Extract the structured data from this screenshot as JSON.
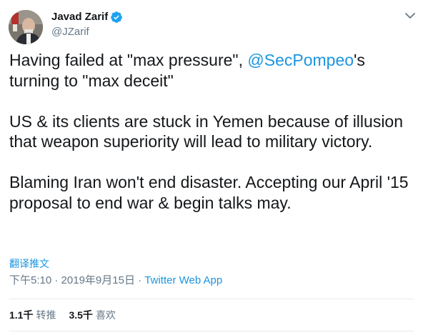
{
  "author": {
    "display_name": "Javad Zarif",
    "handle": "@JZarif",
    "verified": true
  },
  "tweet": {
    "line1_before": "Having failed at \"max pressure\", ",
    "mention": "@SecPompeo",
    "line1_after": "'s turning to \"max deceit\"",
    "paragraph2": "US & its clients are stuck in Yemen because of illusion that weapon superiority will lead to military victory.",
    "paragraph3": "Blaming Iran won't end disaster. Accepting our April '15 proposal to end war & begin talks may."
  },
  "translate_label": "翻译推文",
  "meta": {
    "time": "下午5:10",
    "separator": " · ",
    "date": "2019年9月15日",
    "source": "Twitter Web App"
  },
  "stats": {
    "retweets_count": "1.1千",
    "retweets_label": "转推",
    "likes_count": "3.5千",
    "likes_label": "喜欢"
  },
  "colors": {
    "text": "#14171a",
    "secondary": "#657786",
    "link": "#1b95e0",
    "divider": "#e6ecf0"
  },
  "icons": [
    "avatar",
    "verified-badge-icon",
    "chevron-down-icon"
  ]
}
